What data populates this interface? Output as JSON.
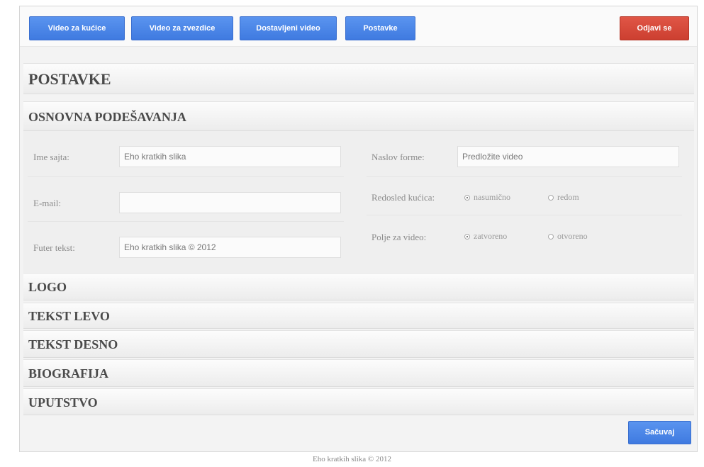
{
  "nav": {
    "video_houses": "Video za kućice",
    "video_stars": "Video za zvezdice",
    "add_video": "Dostavljeni video",
    "settings": "Postavke",
    "logout": "Odjavi se"
  },
  "page_title": "POSTAVKE",
  "basic_settings": {
    "title": "OSNOVNA PODEŠAVANJA",
    "site_name_label": "Ime sajta:",
    "site_name_value": "Eho kratkih slika",
    "email_label": "E-mail:",
    "email_value": "",
    "footer_text_label": "Futer tekst:",
    "footer_text_value": "Eho kratkih slika © 2012",
    "form_title_label": "Naslov forme:",
    "form_title_value": "Predložite video",
    "house_order_label": "Redosled kućica:",
    "house_order_options": [
      "nasumično",
      "redom"
    ],
    "house_order_selected": "nasumično",
    "video_field_label": "Polje za video:",
    "video_field_options": [
      "zatvoreno",
      "otvoreno"
    ],
    "video_field_selected": "zatvoreno"
  },
  "sections": [
    "LOGO",
    "TEKST LEVO",
    "TEKST DESNO",
    "BIOGRAFIJA",
    "UPUTSTVO"
  ],
  "save_label": "Sačuvaj",
  "footer": "Eho kratkih slika © 2012",
  "colors": {
    "primary_button": "#4a86e8",
    "logout_button": "#d64333"
  }
}
